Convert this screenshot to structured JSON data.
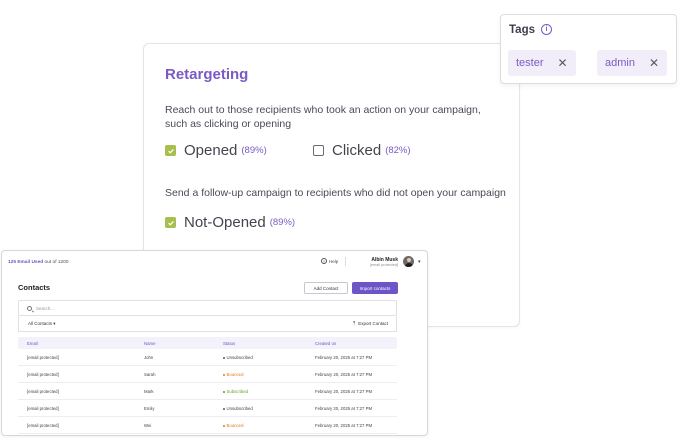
{
  "retargeting": {
    "title": "Retargeting",
    "description1": "Reach out to those recipients who took an action on your campaign, such as clicking or opening",
    "opened": {
      "label": "Opened",
      "pct": "(89%)",
      "checked": true
    },
    "clicked": {
      "label": "Clicked",
      "pct": "(82%)",
      "checked": false
    },
    "description2": "Send a follow-up campaign to recipients who did not open your campaign",
    "not_opened": {
      "label": "Not-Opened",
      "pct": "(89%)",
      "checked": true
    }
  },
  "tags": {
    "title": "Tags",
    "info_icon": "info-icon",
    "items": [
      {
        "label": "tester"
      },
      {
        "label": "admin"
      }
    ],
    "remove_glyph": "✕"
  },
  "contacts_panel": {
    "used": "125 Email Used",
    "out_of": " out of 1200",
    "help": "Help",
    "user": {
      "name": "Albin Musk",
      "email": "[email protected]"
    },
    "title": "Contacts",
    "add_contact": "Add Contact",
    "import_contacts": "Import contacts",
    "search_placeholder": "Search...",
    "filter": "All Contacts",
    "export": "Export Contact",
    "columns": [
      "Email",
      "Name",
      "Status",
      "Created on"
    ],
    "rows": [
      {
        "email": "[email protected]",
        "name": "John",
        "status": "Unsubscribed",
        "status_type": "unsub",
        "created": "February 20, 2025 at 7:27 PM"
      },
      {
        "email": "[email protected]",
        "name": "Sarah",
        "status": "Bounced",
        "status_type": "bounced",
        "created": "February 20, 2025 at 7:27 PM"
      },
      {
        "email": "[email protected]",
        "name": "Mark",
        "status": "Subscribed",
        "status_type": "subscribed",
        "created": "February 20, 2025 at 7:27 PM"
      },
      {
        "email": "[email protected]",
        "name": "Emily",
        "status": "Unsubscribed",
        "status_type": "unsub",
        "created": "February 20, 2025 at 7:27 PM"
      },
      {
        "email": "[email protected]",
        "name": "Wei",
        "status": "Bounced",
        "status_type": "bounced",
        "created": "February 20, 2025 at 7:27 PM"
      }
    ]
  },
  "colors": {
    "accent": "#7b5ac4",
    "primary_button": "#6b55c7",
    "checkbox": "#a7bf4c"
  }
}
